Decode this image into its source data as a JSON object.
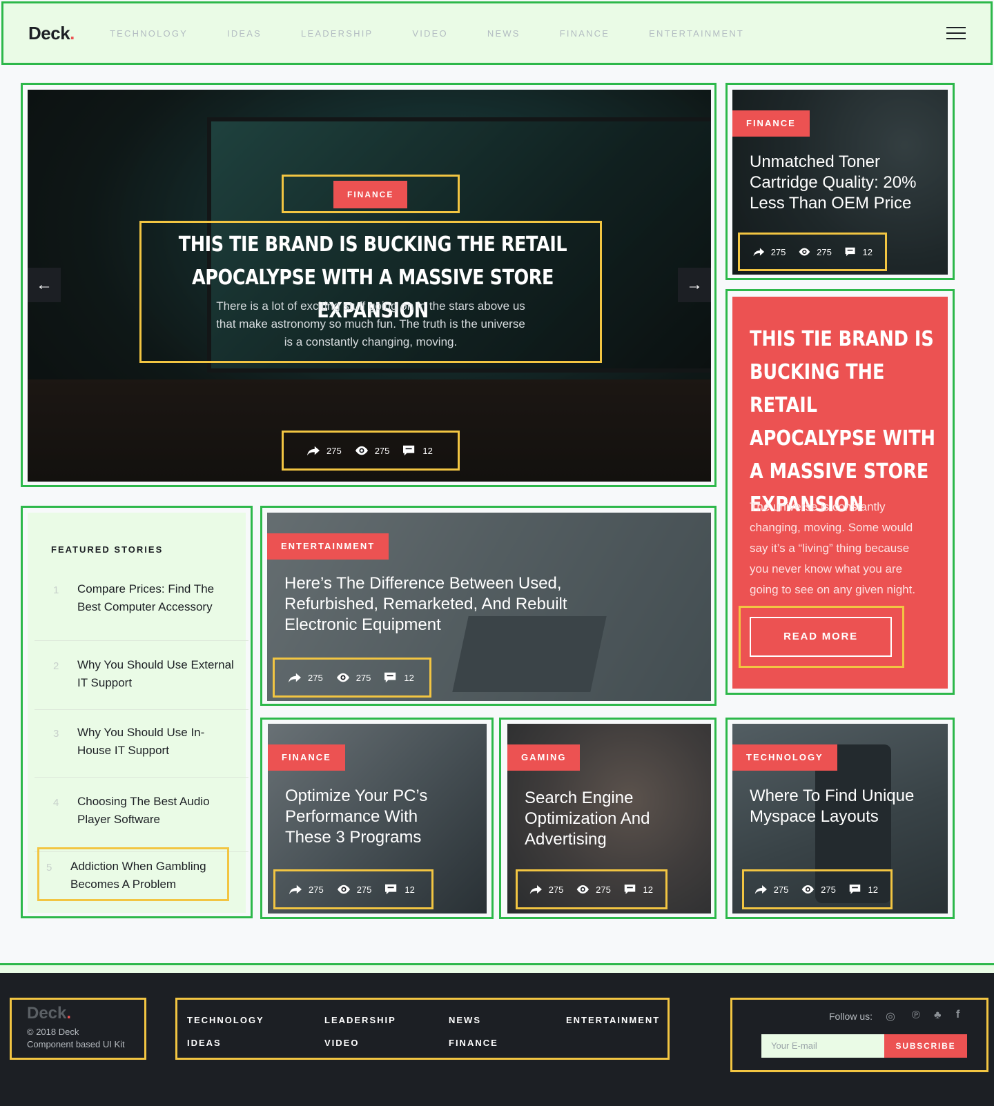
{
  "nav": {
    "logo": "Deck",
    "logo_dot": ".",
    "links": [
      "TECHNOLOGY",
      "IDEAS",
      "LEADERSHIP",
      "VIDEO",
      "NEWS",
      "FINANCE",
      "ENTERTAINMENT"
    ]
  },
  "hero": {
    "tag": "FINANCE",
    "title_line1": "THIS TIE BRAND IS BUCKING THE RETAIL",
    "title_line2": "APOCALYPSE WITH A MASSIVE STORE EXPANSION",
    "excerpt_line1": "There is a lot of exciting stuff going on in the stars above us",
    "excerpt_line2": "that make astronomy so much fun. The truth is the universe",
    "excerpt_line3": "is a constantly changing, moving.",
    "shares": "275",
    "views": "275",
    "comments": "12"
  },
  "side_top": {
    "tag": "FINANCE",
    "title": "Unmatched Toner Cartridge Quality: 20% Less Than OEM Price",
    "shares": "275",
    "views": "275",
    "comments": "12"
  },
  "red_feature": {
    "title": "THIS TIE BRAND IS BUCKING THE RETAIL APOCALYPSE WITH A MASSIVE STORE EXPANSION",
    "body": "The universe is constantly changing, moving. Some would say it’s a “living” thing because you never know what you are going to see on any given night.",
    "button": "READ MORE"
  },
  "featured": {
    "heading": "FEATURED STORIES",
    "items": [
      {
        "n": "1",
        "title": "Compare Prices: Find The Best Computer Accessory"
      },
      {
        "n": "2",
        "title": "Why You Should Use External IT Support"
      },
      {
        "n": "3",
        "title": "Why You Should Use In-House IT Support"
      },
      {
        "n": "4",
        "title": "Choosing The Best Audio Player Software"
      },
      {
        "n": "5",
        "title": "Addiction When Gambling Becomes A Problem"
      }
    ]
  },
  "mid_card": {
    "tag": "ENTERTAINMENT",
    "title": "Here’s The Difference Between Used, Refurbished, Remarketed, And Rebuilt Electronic Equipment",
    "shares": "275",
    "views": "275",
    "comments": "12"
  },
  "card_a": {
    "tag": "FINANCE",
    "title": "Optimize Your PC’s Performance With These 3 Programs",
    "shares": "275",
    "views": "275",
    "comments": "12"
  },
  "card_b": {
    "tag": "GAMING",
    "title": "Search Engine Optimization And Advertising",
    "shares": "275",
    "views": "275",
    "comments": "12"
  },
  "card_c": {
    "tag": "TECHNOLOGY",
    "title": "Where To Find Unique Myspace Layouts",
    "shares": "275",
    "views": "275",
    "comments": "12"
  },
  "footer": {
    "logo": "Deck",
    "logo_dot": ".",
    "copyright": "© 2018 Deck",
    "tagline": "Component based UI Kit",
    "links": [
      "TECHNOLOGY",
      "LEADERSHIP",
      "NEWS",
      "ENTERTAINMENT",
      "IDEAS",
      "VIDEO",
      "FINANCE"
    ],
    "follow": "Follow us:",
    "email_placeholder": "Your E-mail",
    "subscribe": "SUBSCRIBE"
  },
  "colors": {
    "accent": "#ec5252",
    "dark": "#1c1f24",
    "highlight_green": "#2db84a",
    "highlight_yellow": "#f2c542"
  }
}
